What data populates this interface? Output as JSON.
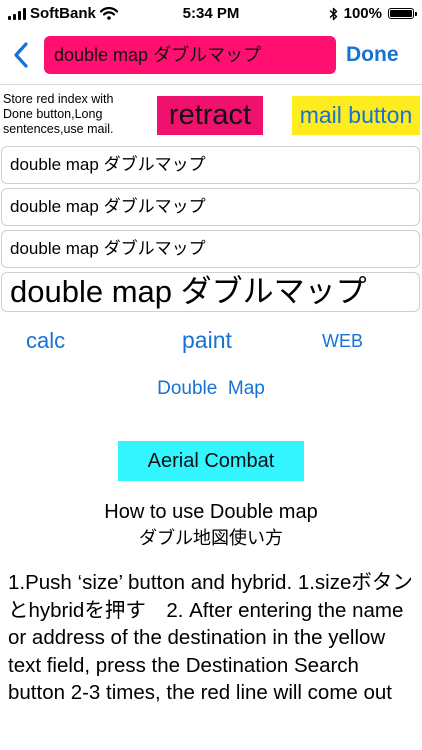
{
  "status_bar": {
    "carrier": "SoftBank",
    "time": "5:34 PM",
    "battery_percent": "100%",
    "battery_level": 1.0,
    "icons": [
      "signal-bars-icon",
      "wifi-icon",
      "bluetooth-icon",
      "battery-icon"
    ]
  },
  "nav": {
    "title_field_value": "double map ダブルマップ",
    "done_label": "Done",
    "back_icon": "chevron-left-icon"
  },
  "toolbar": {
    "info_text": "Store red index with Done button,Long sentences,use mail.",
    "retract_label": "retract",
    "mail_label": "mail button"
  },
  "fields": [
    {
      "value": "double map ダブルマップ"
    },
    {
      "value": "double map ダブルマップ"
    },
    {
      "value": "double map ダブルマップ"
    },
    {
      "value": "double map ダブルマップ"
    }
  ],
  "links": {
    "calc": "calc",
    "paint": "paint",
    "web": "WEB",
    "double_map": "Double  Map"
  },
  "aerial_label": "Aerial Combat",
  "howto": {
    "title": "How to use Double map",
    "subtitle": "ダブル地図使い方",
    "body": "1.Push ‘size’ button and hybrid. 1.sizeボタンとhybridを押す　2. After entering the name or address of the destination in the yellow text field, press the Destination Search button 2-3 times, the red line will come out"
  },
  "colors": {
    "accent_blue": "#1672d4",
    "title_field_pink": "#ff0f6f",
    "retract_pink": "#f0106e",
    "mail_yellow": "#ffec1e",
    "aerial_cyan": "#33f5ff"
  }
}
